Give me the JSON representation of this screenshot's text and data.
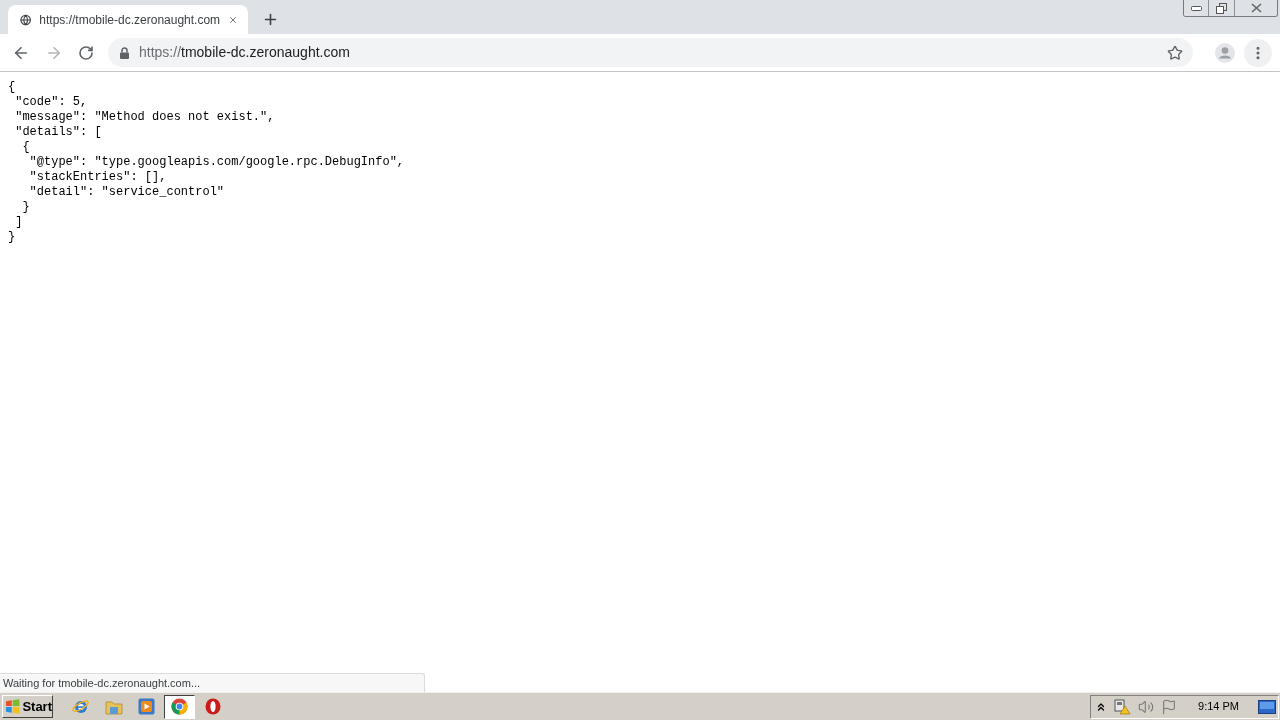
{
  "tabs": [
    {
      "title": "https://tmobile-dc.zeronaught.com",
      "selected": true
    }
  ],
  "toolbar": {
    "back": {
      "disabled": false
    },
    "forward": {
      "disabled": true
    },
    "address": {
      "scheme": "https://",
      "host": "tmobile-dc.zeronaught.com"
    }
  },
  "page": {
    "lines": [
      "{",
      " \"code\": 5,",
      " \"message\": \"Method does not exist.\",",
      " \"details\": [",
      "  {",
      "   \"@type\": \"type.googleapis.com/google.rpc.DebugInfo\",",
      "   \"stackEntries\": [],",
      "   \"detail\": \"service_control\"",
      "  }",
      " ]",
      "}"
    ]
  },
  "status_bubble": "Waiting for tmobile-dc.zeronaught.com...",
  "taskbar": {
    "start": "Start",
    "apps": [
      {
        "selected": false
      },
      {
        "selected": false
      },
      {
        "selected": false
      },
      {
        "selected": true
      },
      {
        "selected": false
      }
    ],
    "clock": "9:14 PM"
  }
}
